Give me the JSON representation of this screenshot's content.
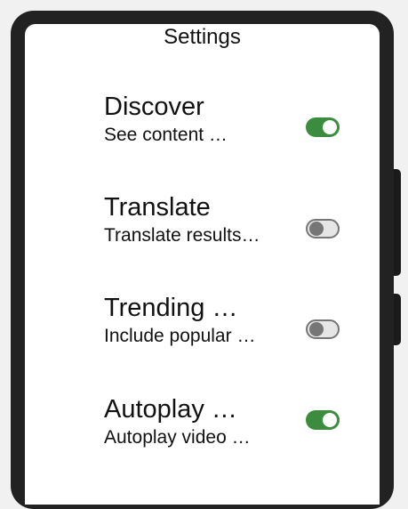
{
  "header": {
    "title": "Settings"
  },
  "settings": [
    {
      "title": "Discover",
      "subtitle": "See content …",
      "enabled": true
    },
    {
      "title": "Translate",
      "subtitle": "Translate results…",
      "enabled": false
    },
    {
      "title": "Trending …",
      "subtitle": "Include popular …",
      "enabled": false
    },
    {
      "title": "Autoplay …",
      "subtitle": "Autoplay video …",
      "enabled": true
    }
  ],
  "colors": {
    "toggle_on": "#3b8c3e",
    "toggle_off_track": "#e6e6e6",
    "toggle_off_knob": "#767676"
  }
}
